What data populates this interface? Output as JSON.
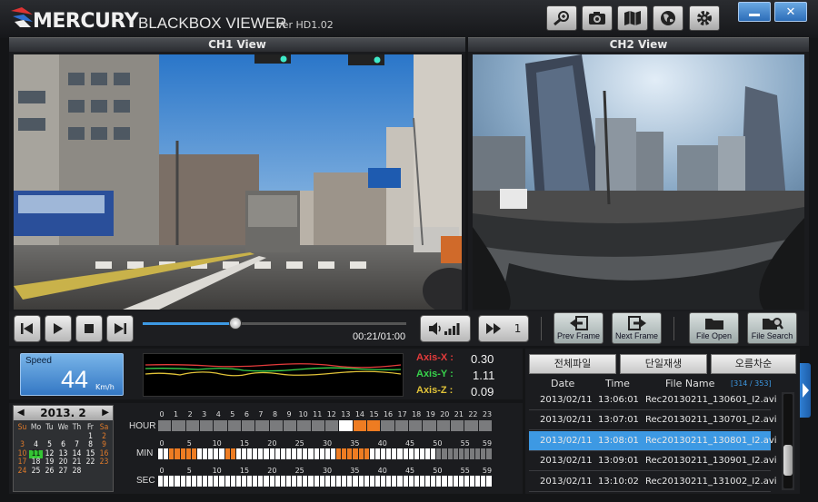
{
  "app": {
    "brand": "MERCURY",
    "product": "BLACKBOX VIEWER",
    "version": "Ver HD1.02"
  },
  "toolbar": {
    "icons": [
      "zoom-in-icon",
      "camera-icon",
      "map-icon",
      "globe-icon",
      "gear-icon"
    ]
  },
  "window": {
    "minimize_icon": "minimize-icon",
    "close_icon": "close-icon"
  },
  "ch1": {
    "title": "CH1 View"
  },
  "ch2": {
    "title": "CH2 View"
  },
  "player": {
    "time": "00:21/01:00",
    "progress": 0.35,
    "speed_value": "1"
  },
  "buttons": {
    "prev_frame": "Prev Frame",
    "next_frame": "Next Frame",
    "file_open": "File Open",
    "file_search": "File Search"
  },
  "speed": {
    "label": "Speed",
    "value": "44",
    "unit": "Km/h"
  },
  "axes": [
    {
      "label": "Axis-X :",
      "value": "0.30",
      "color": "#e43b3b"
    },
    {
      "label": "Axis-Y :",
      "value": "1.11",
      "color": "#37d24b"
    },
    {
      "label": "Axis-Z :",
      "value": "0.09",
      "color": "#e0c238"
    }
  ],
  "calendar": {
    "title": "2013. 2",
    "weekdays": [
      "Su",
      "Mo",
      "Tu",
      "We",
      "Th",
      "Fr",
      "Sa"
    ],
    "weeks": [
      [
        "",
        "",
        "",
        "",
        "",
        "1",
        "2"
      ],
      [
        "3",
        "4",
        "5",
        "6",
        "7",
        "8",
        "9"
      ],
      [
        "10",
        "11",
        "12",
        "13",
        "14",
        "15",
        "16"
      ],
      [
        "17",
        "18",
        "19",
        "20",
        "21",
        "22",
        "23"
      ],
      [
        "24",
        "25",
        "26",
        "27",
        "28",
        "",
        ""
      ]
    ],
    "highlight_days": [
      "4",
      "5",
      "6",
      "7",
      "8",
      "9",
      "10",
      "11",
      "12",
      "13",
      "14",
      "15",
      "16"
    ],
    "selected_day": "11"
  },
  "timeline": {
    "hour_label": "HOUR",
    "min_label": "MIN",
    "sec_label": "SEC",
    "hour_ticks": [
      "0",
      "1",
      "2",
      "3",
      "4",
      "5",
      "6",
      "7",
      "8",
      "9",
      "10",
      "11",
      "12",
      "13",
      "14",
      "15",
      "16",
      "17",
      "18",
      "19",
      "20",
      "21",
      "22",
      "23"
    ],
    "min_ticks": [
      "0",
      "5",
      "10",
      "15",
      "20",
      "25",
      "30",
      "35",
      "40",
      "45",
      "50",
      "55",
      "59"
    ],
    "sec_ticks": [
      "0",
      "5",
      "10",
      "15",
      "20",
      "25",
      "30",
      "35",
      "40",
      "45",
      "50",
      "55",
      "59"
    ]
  },
  "filelist": {
    "tabs": [
      "전체파일",
      "단일재생",
      "오름차순"
    ],
    "columns": [
      "Date",
      "Time",
      "File Name"
    ],
    "count": "[314 / 353]",
    "rows": [
      {
        "date": "2013/02/11",
        "time": "13:06:01",
        "name": "Rec20130211_130601_I2.avi",
        "selected": false
      },
      {
        "date": "2013/02/11",
        "time": "13:07:01",
        "name": "Rec20130211_130701_I2.avi",
        "selected": false
      },
      {
        "date": "2013/02/11",
        "time": "13:08:01",
        "name": "Rec20130211_130801_I2.avi",
        "selected": true
      },
      {
        "date": "2013/02/11",
        "time": "13:09:01",
        "name": "Rec20130211_130901_I2.avi",
        "selected": false
      },
      {
        "date": "2013/02/11",
        "time": "13:10:02",
        "name": "Rec20130211_131002_I2.avi",
        "selected": false
      }
    ]
  }
}
